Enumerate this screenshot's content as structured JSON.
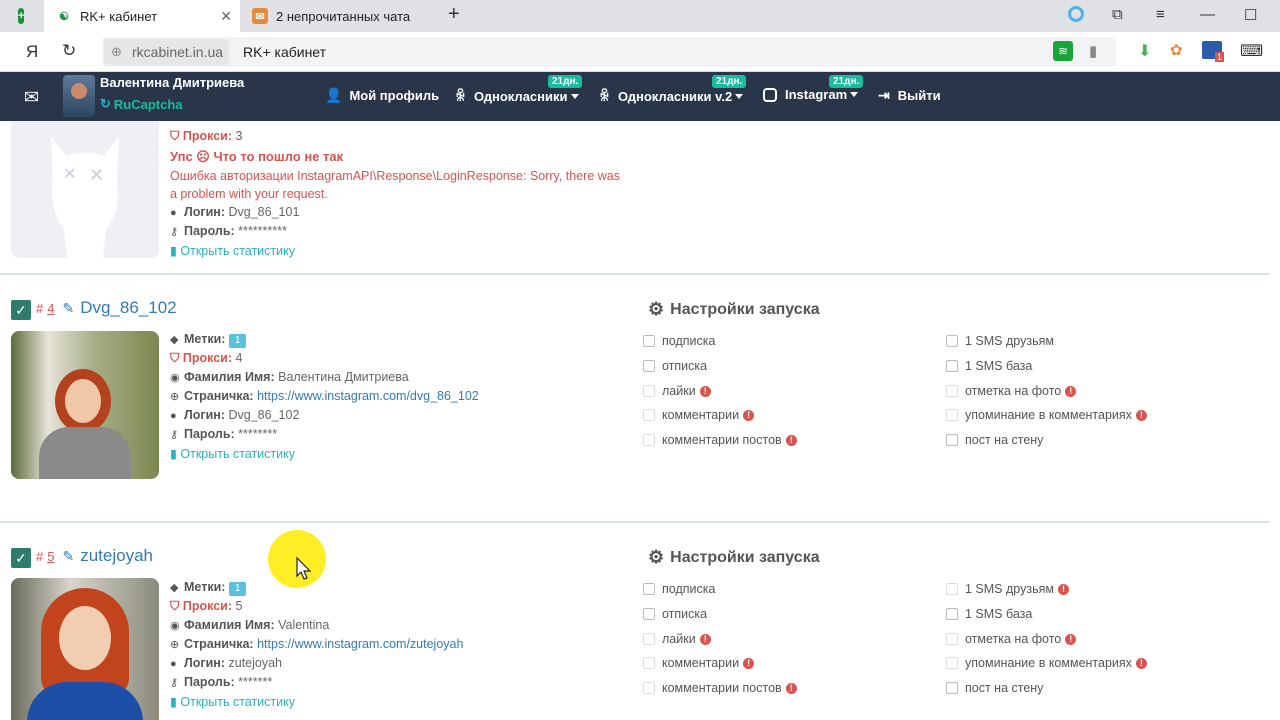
{
  "browser": {
    "tabs": [
      {
        "title": "RK+ кабинет",
        "active": true
      },
      {
        "title": "2 непрочитанных чата",
        "active": false
      }
    ],
    "yandex_logo": "Я",
    "domain": "rkcabinet.in.ua",
    "page_title": "RK+ кабинет"
  },
  "nav": {
    "user_name": "Валентина Дмитриева",
    "captcha": "RuCaptcha",
    "items": [
      {
        "label": "Мой профиль",
        "badge": ""
      },
      {
        "label": "Однокласники",
        "badge": "21дн."
      },
      {
        "label": "Однокласники v.2",
        "badge": "21дн."
      },
      {
        "label": "Instagram",
        "badge": "21дн."
      },
      {
        "label": "Выйти",
        "badge": ""
      }
    ]
  },
  "labels": {
    "tags": "Метки:",
    "proxy": "Прокси:",
    "name": "Фамилия Имя:",
    "page": "Страничка:",
    "login": "Логин:",
    "password": "Пароль:",
    "stats": "Открыть статистику",
    "settings": "Настройки запуска"
  },
  "options_left": [
    "подписка",
    "отписка",
    "лайки",
    "комментарии",
    "комментарии постов"
  ],
  "options_right": [
    "1 SMS друзьям",
    "1 SMS база",
    "отметка на фото",
    "упоминание в комментариях",
    "пост на стену"
  ],
  "accounts": [
    {
      "proxy": "3",
      "error_title": "Упс ☹ Что то пошло не так",
      "error_text": "Ошибка авторизации InstagramAPI\\Response\\LoginResponse: Sorry, there was a problem with your request.",
      "login": "Dvg_86_101",
      "password": "**********"
    },
    {
      "num_prefix": "#",
      "num": "4",
      "username": "Dvg_86_102",
      "tags": "1",
      "proxy": "4",
      "name": "Валентина Дмитриева",
      "page": "https://www.instagram.com/dvg_86_102",
      "login": "Dvg_86_102",
      "password": "********"
    },
    {
      "num_prefix": "#",
      "num": "5",
      "username": "zutejoyah",
      "tags": "1",
      "proxy": "5",
      "name": "Valentina",
      "page": "https://www.instagram.com/zutejoyah",
      "login": "zutejoyah",
      "password": "*******"
    }
  ]
}
